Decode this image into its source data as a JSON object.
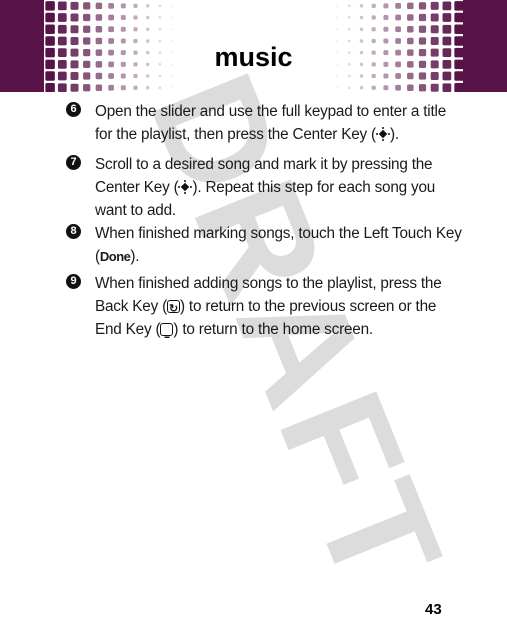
{
  "header": {
    "title": "music",
    "brand_color": "#571347"
  },
  "watermark": {
    "text": "DRAFT",
    "color": "#dcdcdc"
  },
  "steps": [
    {
      "number": "6",
      "parts": [
        {
          "type": "text",
          "value": "Open the slider and use the full keypad to enter a title for the playlist, then press the Center Key ("
        },
        {
          "type": "icon",
          "value": "center-key-icon"
        },
        {
          "type": "text",
          "value": ")."
        }
      ]
    },
    {
      "number": "7",
      "parts": [
        {
          "type": "text",
          "value": "Scroll to a desired song and mark it by pressing the Center Key ("
        },
        {
          "type": "icon",
          "value": "center-key-icon"
        },
        {
          "type": "text",
          "value": "). Repeat this step for each song you want to add."
        }
      ]
    },
    {
      "number": "8",
      "parts": [
        {
          "type": "text",
          "value": "When finished marking songs, touch the Left Touch Key ("
        },
        {
          "type": "bold",
          "value": "Done"
        },
        {
          "type": "text",
          "value": ")."
        }
      ]
    },
    {
      "number": "9",
      "parts": [
        {
          "type": "text",
          "value": "When finished adding songs to the playlist, press the Back Key ("
        },
        {
          "type": "icon",
          "value": "back-key-icon"
        },
        {
          "type": "text",
          "value": ") to return to the previous screen or the End Key ("
        },
        {
          "type": "icon",
          "value": "end-key-icon"
        },
        {
          "type": "text",
          "value": ") to return to the home screen."
        }
      ]
    }
  ],
  "footer": {
    "page_number": "43"
  }
}
